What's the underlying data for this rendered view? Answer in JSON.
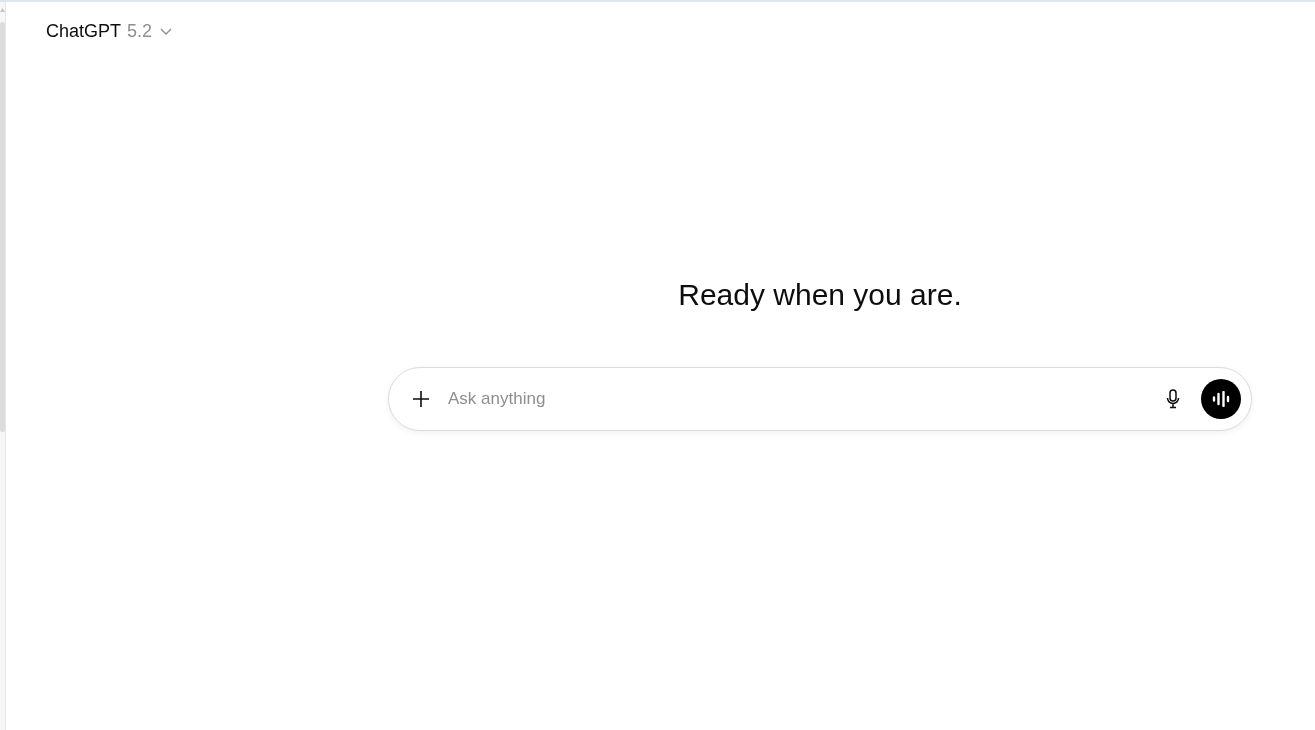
{
  "header": {
    "model_name": "ChatGPT",
    "model_version": "5.2"
  },
  "heading": "Ready when you are.",
  "composer": {
    "placeholder": "Ask anything"
  }
}
